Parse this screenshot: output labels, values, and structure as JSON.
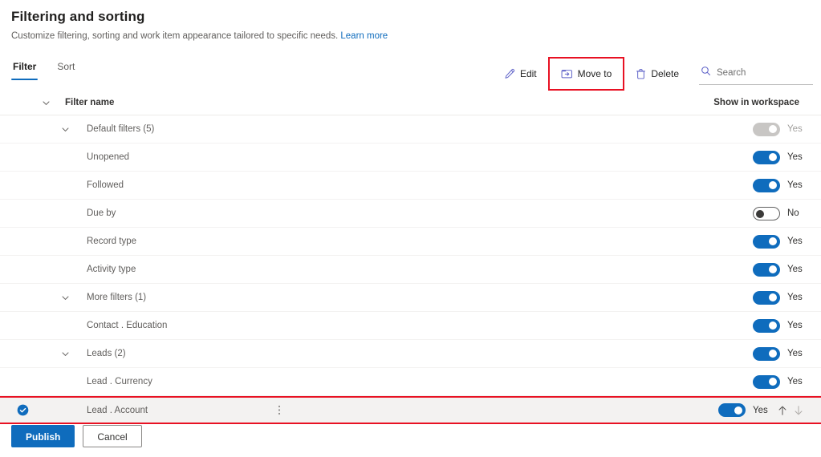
{
  "header": {
    "title": "Filtering and sorting",
    "subtitle": "Customize filtering, sorting and work item appearance tailored to specific needs.",
    "learn_more": "Learn more"
  },
  "tabs": [
    {
      "label": "Filter",
      "active": true
    },
    {
      "label": "Sort",
      "active": false
    }
  ],
  "commands": {
    "edit": "Edit",
    "move_to": "Move to",
    "delete": "Delete",
    "search_placeholder": "Search",
    "search_value": "",
    "highlighted": "move_to"
  },
  "table": {
    "columns": {
      "filter_name": "Filter name",
      "show_in_workspace": "Show in workspace"
    },
    "rows": [
      {
        "label": "Default filters (5)",
        "type": "group",
        "expanded": true,
        "toggle": "on",
        "toggle_label": "Yes",
        "toggle_disabled": true,
        "selected": false
      },
      {
        "label": "Unopened",
        "type": "item",
        "toggle": "on",
        "toggle_label": "Yes",
        "toggle_disabled": false,
        "selected": false
      },
      {
        "label": "Followed",
        "type": "item",
        "toggle": "on",
        "toggle_label": "Yes",
        "toggle_disabled": false,
        "selected": false
      },
      {
        "label": "Due by",
        "type": "item",
        "toggle": "off",
        "toggle_label": "No",
        "toggle_disabled": false,
        "selected": false
      },
      {
        "label": "Record type",
        "type": "item",
        "toggle": "on",
        "toggle_label": "Yes",
        "toggle_disabled": false,
        "selected": false
      },
      {
        "label": "Activity type",
        "type": "item",
        "toggle": "on",
        "toggle_label": "Yes",
        "toggle_disabled": false,
        "selected": false
      },
      {
        "label": "More filters (1)",
        "type": "group",
        "expanded": true,
        "toggle": "on",
        "toggle_label": "Yes",
        "toggle_disabled": false,
        "selected": false
      },
      {
        "label": "Contact . Education",
        "type": "item",
        "toggle": "on",
        "toggle_label": "Yes",
        "toggle_disabled": false,
        "selected": false
      },
      {
        "label": "Leads (2)",
        "type": "group",
        "expanded": true,
        "toggle": "on",
        "toggle_label": "Yes",
        "toggle_disabled": false,
        "selected": false
      },
      {
        "label": "Lead . Currency",
        "type": "item",
        "toggle": "on",
        "toggle_label": "Yes",
        "toggle_disabled": false,
        "selected": false
      },
      {
        "label": "Lead . Account",
        "type": "item",
        "toggle": "on",
        "toggle_label": "Yes",
        "toggle_disabled": false,
        "selected": true
      }
    ]
  },
  "footer": {
    "publish": "Publish",
    "cancel": "Cancel"
  },
  "colors": {
    "accent": "#0f6cbd",
    "highlight": "#e81123",
    "link": "#0f6cbd",
    "toggle_on": "#0f6cbd",
    "toggle_disabled": "#c8c6c4"
  }
}
